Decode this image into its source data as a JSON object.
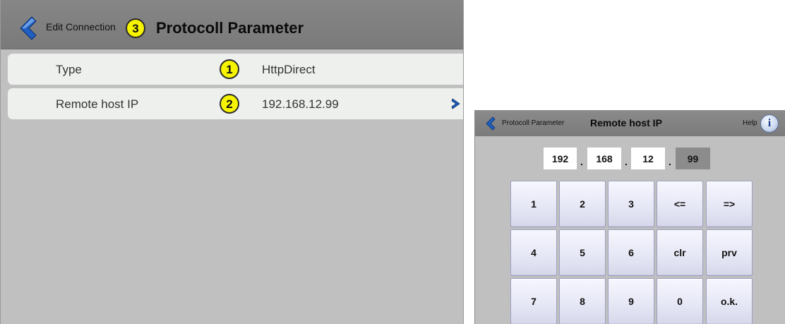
{
  "left": {
    "back_label": "Edit Connection",
    "header_badge": "3",
    "title": "Protocoll Parameter",
    "rows": [
      {
        "label": "Type",
        "badge": "1",
        "value": "HttpDirect"
      },
      {
        "label": "Remote host IP",
        "badge": "2",
        "value": "192.168.12.99"
      }
    ]
  },
  "right": {
    "back_label": "Protocoll Parameter",
    "title": "Remote host IP",
    "help_label": "Help",
    "help_icon": "i",
    "ip": [
      "192",
      "168",
      "12",
      "99"
    ],
    "ip_separator": ".",
    "keys": [
      [
        "1",
        "2",
        "3",
        "<=",
        "=>"
      ],
      [
        "4",
        "5",
        "6",
        "clr",
        "prv"
      ],
      [
        "7",
        "8",
        "9",
        "0",
        "o.k."
      ]
    ]
  },
  "colors": {
    "badge_yellow": "#f7f400",
    "arrow_blue": "#1f5fbf",
    "header_gray": "#808080",
    "panel_gray": "#c0c0c0",
    "key_fill": "#e7e8f6"
  },
  "icons": {
    "left_back": "back-arrow-icon",
    "row_chevron": "chevron-right-icon",
    "right_back": "back-arrow-icon",
    "help": "info-icon"
  }
}
